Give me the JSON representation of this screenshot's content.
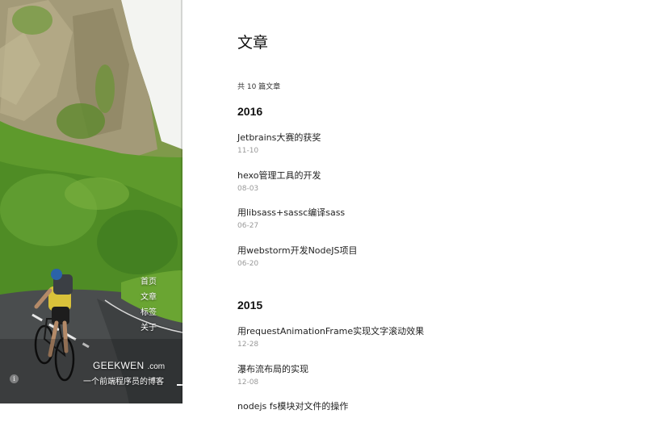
{
  "sidebar": {
    "nav": [
      "首页",
      "文章",
      "标签",
      "关于"
    ],
    "brand": "GEEKWEN",
    "brand_suffix": ".com",
    "tagline": "一个前端程序员的博客",
    "info_icon": "info-icon"
  },
  "main": {
    "title": "文章",
    "count": "共 10 篇文章",
    "years": [
      {
        "year": "2016",
        "posts": [
          {
            "title": "Jetbrains大赛的获奖",
            "date": "11-10"
          },
          {
            "title": "hexo管理工具的开发",
            "date": "08-03"
          },
          {
            "title": "用libsass+sassc编译sass",
            "date": "06-27"
          },
          {
            "title": "用webstorm开发NodeJS项目",
            "date": "06-20"
          }
        ]
      },
      {
        "year": "2015",
        "posts": [
          {
            "title": "用requestAnimationFrame实现文字滚动效果",
            "date": "12-28"
          },
          {
            "title": "瀑布流布局的实现",
            "date": "12-08"
          },
          {
            "title": "nodejs fs模块对文件的操作",
            "date": ""
          }
        ]
      }
    ]
  },
  "colors": {
    "accent_text": "#222222",
    "date_text": "#999999",
    "sidebar_green": "#4d7a2a"
  }
}
